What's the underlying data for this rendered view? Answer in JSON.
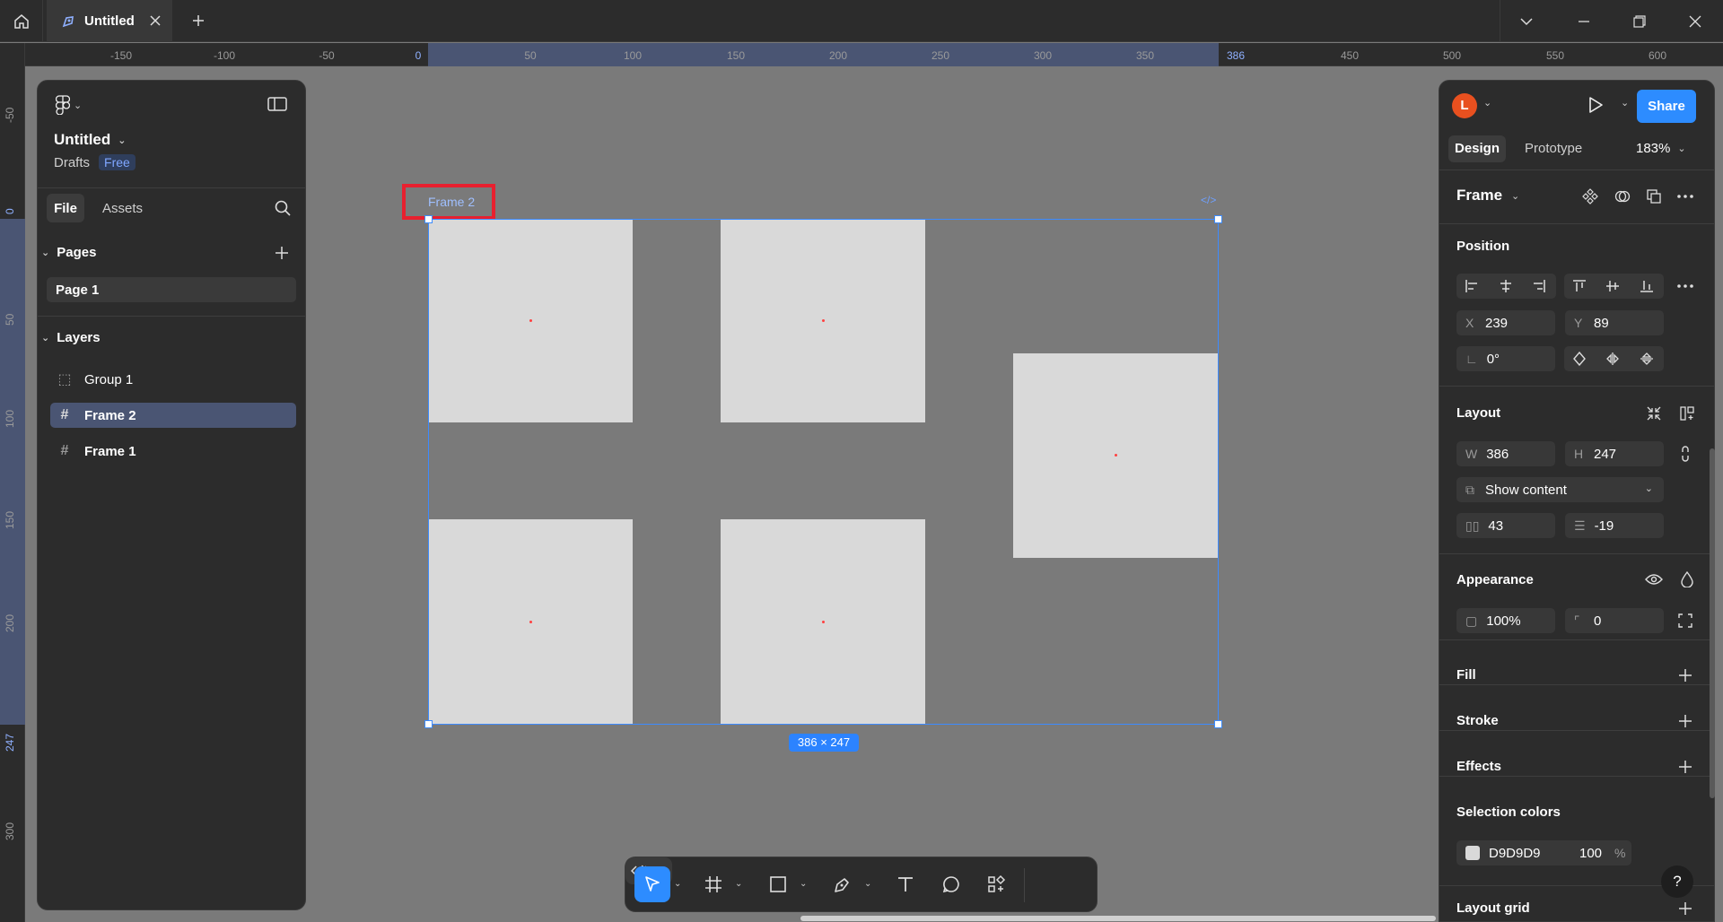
{
  "titlebar": {
    "tab_title": "Untitled"
  },
  "rulers": {
    "top": [
      "-150",
      "-100",
      "-50",
      "0",
      "50",
      "100",
      "150",
      "200",
      "250",
      "300",
      "350",
      "386",
      "450",
      "500",
      "550",
      "600"
    ],
    "left": [
      "-50",
      "0",
      "50",
      "100",
      "150",
      "200",
      "247",
      "300"
    ]
  },
  "left_panel": {
    "file_name": "Untitled",
    "location": "Drafts",
    "plan_badge": "Free",
    "tabs": {
      "file": "File",
      "assets": "Assets"
    },
    "pages_heading": "Pages",
    "pages": [
      "Page 1"
    ],
    "layers_heading": "Layers",
    "layers": [
      {
        "name": "Group 1",
        "icon": "group-icon",
        "selected": false
      },
      {
        "name": "Frame 2",
        "icon": "frame-icon",
        "selected": true
      },
      {
        "name": "Frame 1",
        "icon": "frame-icon",
        "selected": false
      }
    ]
  },
  "canvas": {
    "frame_label": "Frame 2",
    "size_badge": "386 × 247",
    "fill_color": "#D9D9D9",
    "selection_color": "#3D8BFF",
    "highlight_box_color": "#E8202F"
  },
  "right_panel": {
    "avatar_initial": "L",
    "share_label": "Share",
    "tabs": {
      "design": "Design",
      "prototype": "Prototype"
    },
    "zoom": "183%",
    "selection_type": "Frame",
    "position": {
      "heading": "Position",
      "x_label": "X",
      "x": "239",
      "y_label": "Y",
      "y": "89",
      "rotation": "0°"
    },
    "layout": {
      "heading": "Layout",
      "w_label": "W",
      "w": "386",
      "h_label": "H",
      "h": "247",
      "clip": "Show content",
      "h_gap": "43",
      "v_gap": "-19"
    },
    "appearance": {
      "heading": "Appearance",
      "opacity": "100%",
      "radius": "0"
    },
    "fill_heading": "Fill",
    "stroke_heading": "Stroke",
    "effects_heading": "Effects",
    "selection_colors": {
      "heading": "Selection colors",
      "hex": "D9D9D9",
      "opacity": "100",
      "percent": "%"
    },
    "layout_grid_heading": "Layout grid",
    "help": "?"
  }
}
